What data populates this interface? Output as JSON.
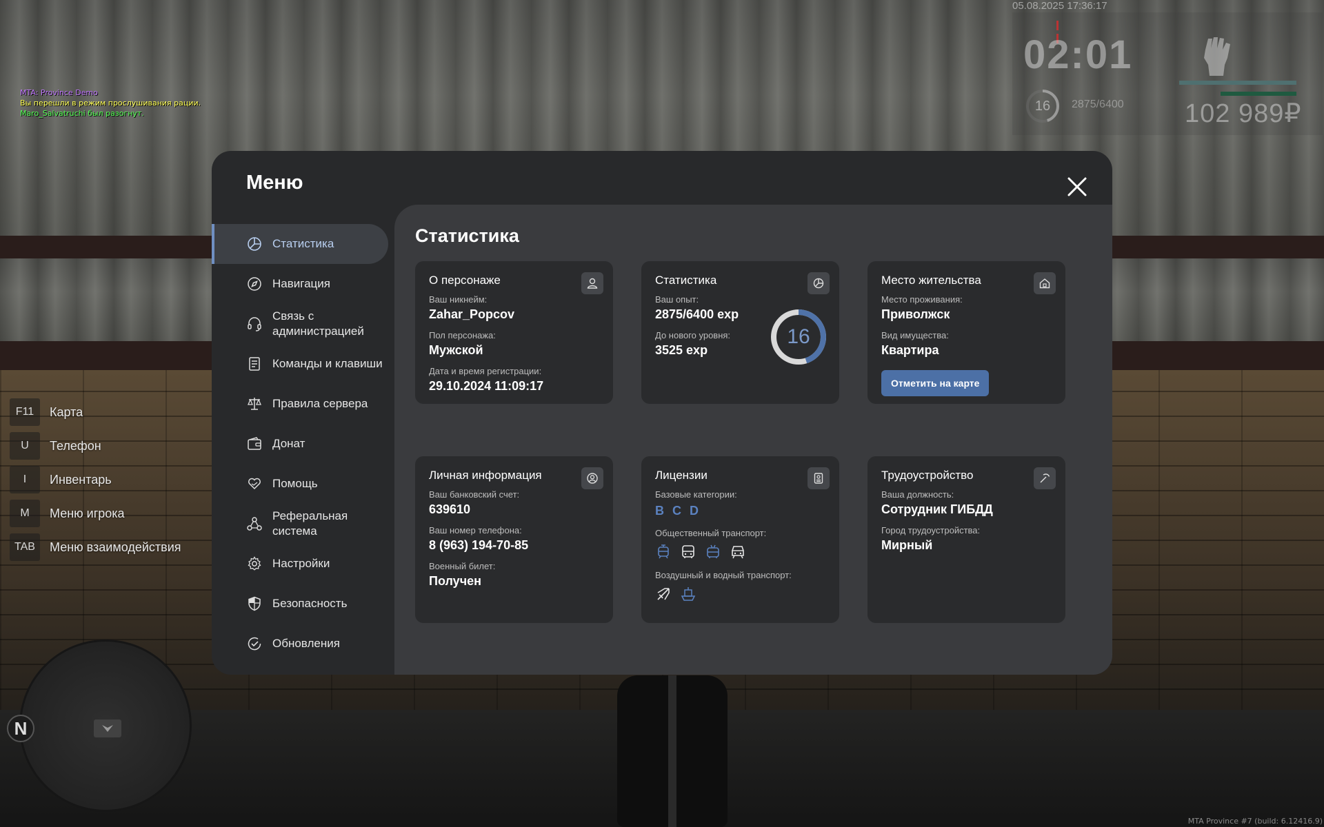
{
  "chat": {
    "line1": "MTA: Province Demo",
    "line2": "Вы перешли в режим прослушивания рации.",
    "line3": "Maro_Salvatruchi был разогнут."
  },
  "hud": {
    "datetime": "05.08.2025 17:36:17",
    "time": "02:01",
    "level": "16",
    "exp": "2875/6400",
    "level_progress": 0.45,
    "money": "102 989₽"
  },
  "hotkeys": [
    {
      "key": "F11",
      "label": "Карта"
    },
    {
      "key": "U",
      "label": "Телефон"
    },
    {
      "key": "I",
      "label": "Инвентарь"
    },
    {
      "key": "M",
      "label": "Меню игрока"
    },
    {
      "key": "TAB",
      "label": "Меню взаимодействия"
    }
  ],
  "minimap": {
    "compass": "N"
  },
  "menu": {
    "title": "Меню",
    "nav": [
      {
        "label": "Статистика",
        "icon": "pie-chart-icon",
        "active": true
      },
      {
        "label": "Навигация",
        "icon": "compass-icon"
      },
      {
        "label": "Связь с администрацией",
        "icon": "headset-icon"
      },
      {
        "label": "Команды и клавиши",
        "icon": "document-icon"
      },
      {
        "label": "Правила сервера",
        "icon": "scales-icon"
      },
      {
        "label": "Донат",
        "icon": "wallet-icon"
      },
      {
        "label": "Помощь",
        "icon": "heart-hand-icon"
      },
      {
        "label": "Реферальная система",
        "icon": "network-icon"
      },
      {
        "label": "Настройки",
        "icon": "gear-icon"
      },
      {
        "label": "Безопасность",
        "icon": "shield-icon"
      },
      {
        "label": "Обновления",
        "icon": "check-circle-icon"
      }
    ]
  },
  "content": {
    "title": "Статистика",
    "character": {
      "title": "О персонаже",
      "nickname_label": "Ваш никнейм:",
      "nickname": "Zahar_Popcov",
      "gender_label": "Пол персонажа:",
      "gender": "Мужской",
      "reg_label": "Дата и время регистрации:",
      "reg": "29.10.2024 11:09:17"
    },
    "stats": {
      "title": "Статистика",
      "exp_label": "Ваш опыт:",
      "exp": "2875/6400 exp",
      "next_label": "До нового уровня:",
      "next": "3525 exp",
      "level": "16",
      "level_progress": 0.45
    },
    "residence": {
      "title": "Место жительства",
      "place_label": "Место проживания:",
      "place": "Приволжск",
      "type_label": "Вид имущества:",
      "type": "Квартира",
      "button": "Отметить на карте"
    },
    "personal": {
      "title": "Личная информация",
      "bank_label": "Ваш банковский счет:",
      "bank": "639610",
      "phone_label": "Ваш номер телефона:",
      "phone": "8 (963) 194-70-85",
      "military_label": "Военный билет:",
      "military": "Получен"
    },
    "licenses": {
      "title": "Лицензии",
      "base_label": "Базовые категории:",
      "base": [
        "B",
        "C",
        "D"
      ],
      "public_label": "Общественный транспорт:",
      "public_icons": [
        "tram-icon",
        "bus-icon",
        "trolleybus-icon",
        "train-icon"
      ],
      "air_label": "Воздушный и водный транспорт:",
      "air_icons": [
        "plane-icon",
        "boat-icon"
      ]
    },
    "job": {
      "title": "Трудоустройство",
      "position_label": "Ваша должность:",
      "position": "Сотрудник ГИБДД",
      "city_label": "Город трудоустройства:",
      "city": "Мирный"
    }
  },
  "build": "MTA Province #7 (build: 6.12416.9)",
  "colors": {
    "accent": "#4c70a6",
    "accent_text": "#5b82c0",
    "panel": "#28292b",
    "content": "#3a3b3e",
    "card": "#2a2b2d"
  }
}
